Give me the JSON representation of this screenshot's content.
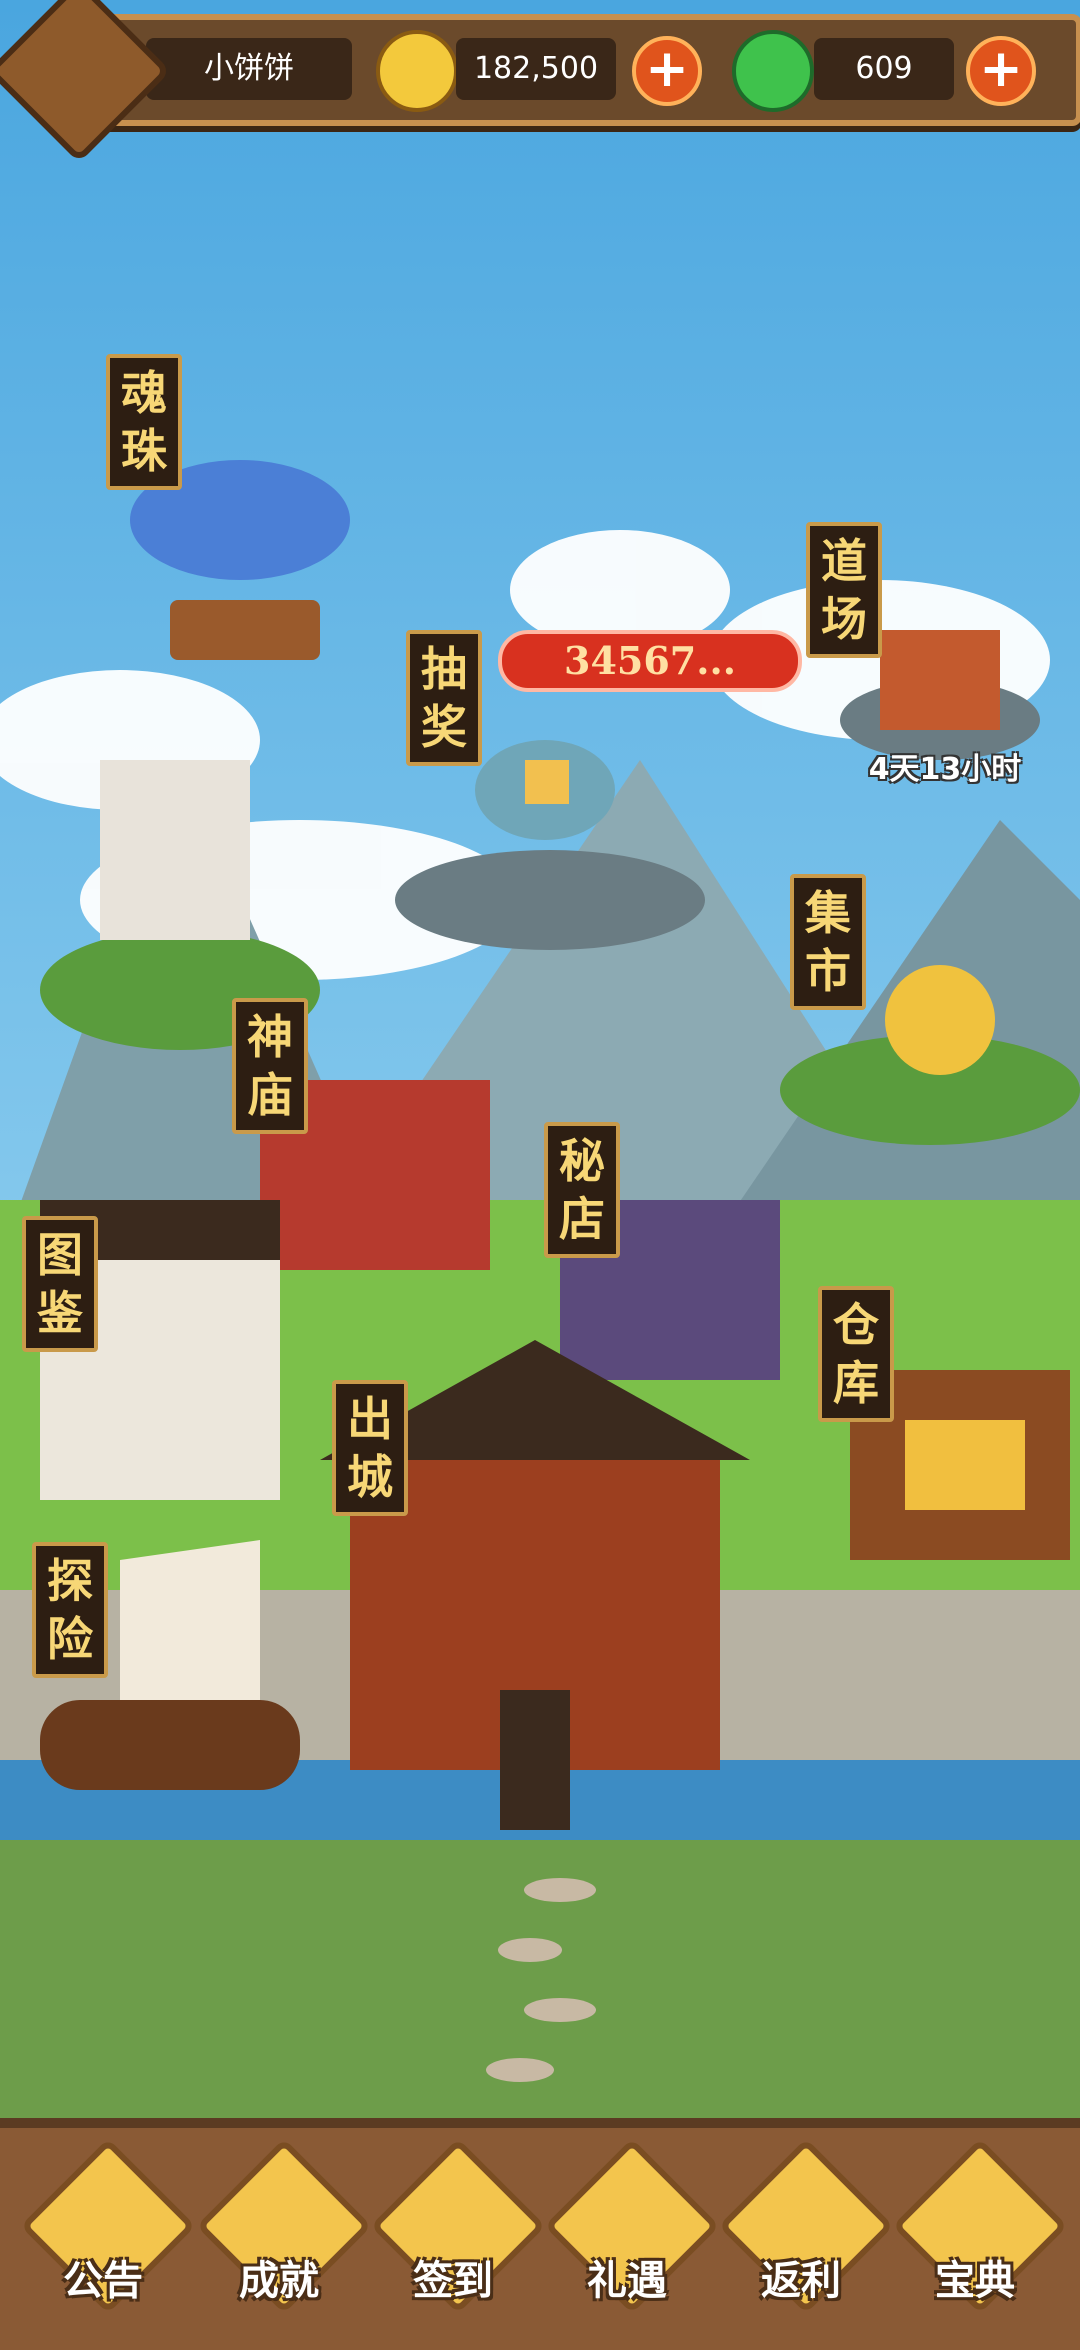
{
  "header": {
    "player_name": "小饼饼",
    "gold": "182,500",
    "jade": "609"
  },
  "buildings": {
    "soul_orb": [
      "魂",
      "珠"
    ],
    "lottery": [
      "抽",
      "奖"
    ],
    "dojo": [
      "道",
      "场"
    ],
    "market": [
      "集",
      "市"
    ],
    "temple": [
      "神",
      "庙"
    ],
    "secret_shop": [
      "秘",
      "店"
    ],
    "atlas": [
      "图",
      "鉴"
    ],
    "warehouse": [
      "仓",
      "库"
    ],
    "exit_city": [
      "出",
      "城"
    ],
    "explore": [
      "探",
      "险"
    ]
  },
  "lottery_counter": "34567...",
  "dojo_timer": "4天13小时",
  "bottom_nav": [
    {
      "label": "公告",
      "icon": "notice-icon"
    },
    {
      "label": "成就",
      "icon": "achievement-icon"
    },
    {
      "label": "签到",
      "icon": "signin-icon"
    },
    {
      "label": "礼遇",
      "icon": "gift-cat-icon"
    },
    {
      "label": "返利",
      "icon": "rebate-pig-icon"
    },
    {
      "label": "宝典",
      "icon": "book-icon"
    }
  ],
  "colors": {
    "sky": "#5fb6e6",
    "grass": "#7cc04a",
    "label_bg": "#2d1e12",
    "label_text": "#f7d776",
    "accent_red": "#d8311f"
  }
}
